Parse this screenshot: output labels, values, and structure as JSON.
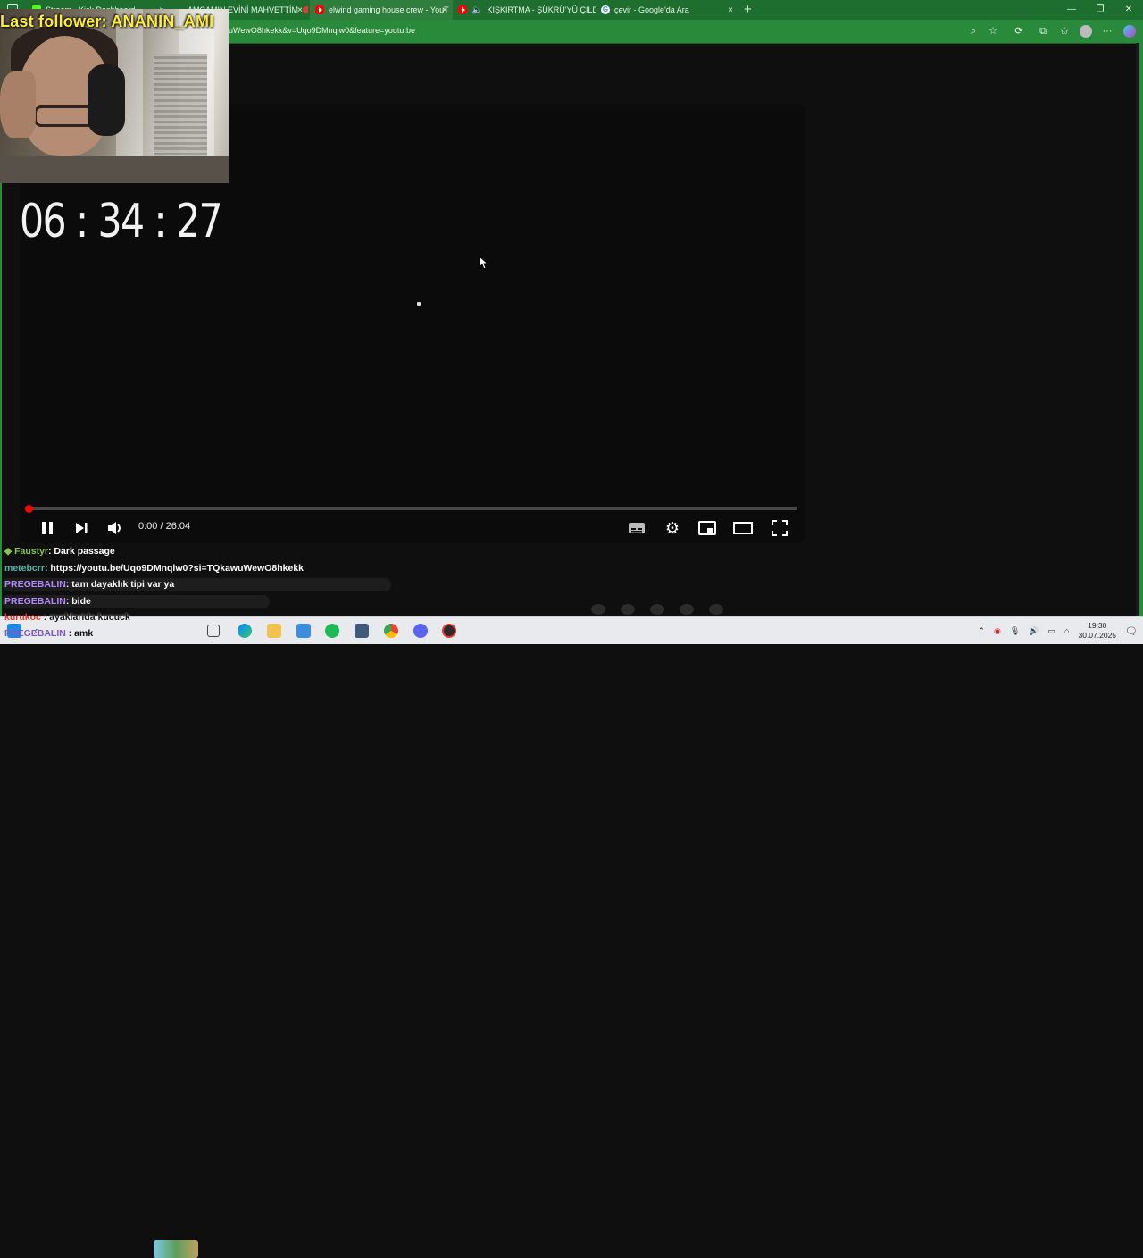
{
  "browser": {
    "tabs": [
      {
        "title": "Stream - Kick Dashboard",
        "favicon": "kick-icon"
      },
      {
        "title": "AMCAMIN EVİNİ MAHVETTİM",
        "favicon": "recording-icon"
      },
      {
        "title": "elwind gaming house crew - YouT",
        "favicon": "youtube-icon"
      },
      {
        "title": "KIŞKIRTMA - ŞÜKRÜ'YÜ ÇILDI",
        "favicon": "youtube-icon"
      },
      {
        "title": "çevir - Google'da Ara",
        "favicon": "google-icon"
      }
    ],
    "close_glyph": "×",
    "new_tab_glyph": "+",
    "url": "uWewO8hkekk&v=Uqo9DMnqlw0&feature=youtu.be",
    "accent": "#2a8a3b"
  },
  "overlay": {
    "follower_text": "Last follower: ANANIN_AMI",
    "timer": "06 : 34 : 27"
  },
  "player": {
    "time_display": "0:00 / 26:04",
    "progress": 0
  },
  "chat": {
    "messages": [
      {
        "user": "Faustyr",
        "color": "#8bc34a",
        "text": " : Dark passage",
        "badge": true
      },
      {
        "user": "metebcrr",
        "color": "#4db6ac",
        "text": " : https://youtu.be/Uqo9DMnqlw0?si=TQkawuWewO8hkekk"
      },
      {
        "user": "PREGEBALIN",
        "color": "#b388ff",
        "text": " : tam dayaklık tipi var ya"
      },
      {
        "user": "PREGEBALIN",
        "color": "#b388ff",
        "text": " : bide"
      },
      {
        "user": "kurukoc",
        "color": "#e53935",
        "text": " : ayaklarida kucuck"
      },
      {
        "user": "PREGEBALIN",
        "color": "#b388ff",
        "text": " : amk"
      }
    ]
  },
  "taskbar": {
    "time": "19:30",
    "date": "30.07.2025"
  }
}
